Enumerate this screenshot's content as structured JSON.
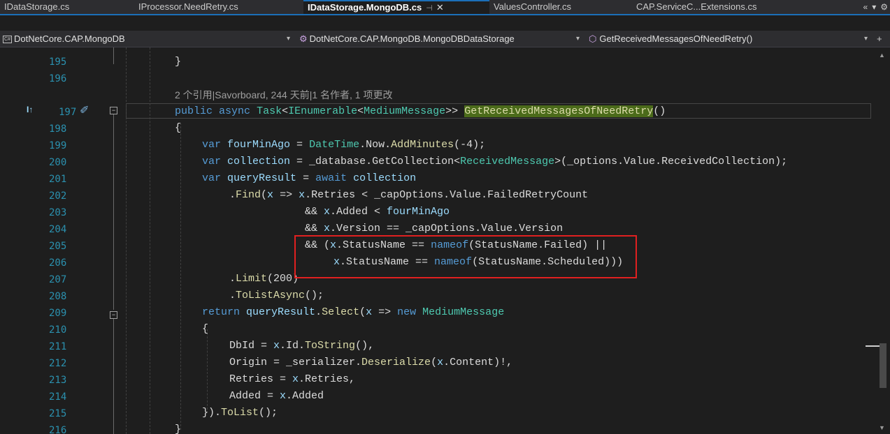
{
  "tabs": [
    {
      "label": "IDataStorage.cs",
      "active": false
    },
    {
      "label": "IProcessor.NeedRetry.cs",
      "active": false
    },
    {
      "label": "IDataStorage.MongoDB.cs",
      "active": true,
      "pin": "⊣",
      "close": "✕"
    },
    {
      "label": "ValuesController.cs",
      "active": false
    },
    {
      "label": "CAP.ServiceC...Extensions.cs",
      "active": false
    }
  ],
  "tab_icons": {
    "overflow": "«",
    "dropdown": "▾",
    "settings": "⚙"
  },
  "nav": {
    "project": "DotNetCore.CAP.MongoDB",
    "class": "DotNetCore.CAP.MongoDB.MongoDBDataStorage",
    "member": "GetReceivedMessagesOfNeedRetry()",
    "split": "+",
    "dropdown": "▾"
  },
  "codelens": "2 个引用|Savorboard, 244 天前|1 名作者, 1 项更改",
  "gutter": {
    "status_icon": "I↑",
    "pencil": "✐"
  },
  "lines": [
    {
      "n": "195",
      "text": "}"
    },
    {
      "n": "196",
      "text": ""
    },
    {
      "n": "197",
      "text": "public async Task<IEnumerable<MediumMessage>> GetReceivedMessagesOfNeedRetry()"
    },
    {
      "n": "198",
      "text": "{"
    },
    {
      "n": "199",
      "text": "var fourMinAgo = DateTime.Now.AddMinutes(-4);"
    },
    {
      "n": "200",
      "text": "var collection = _database.GetCollection<ReceivedMessage>(_options.Value.ReceivedCollection);"
    },
    {
      "n": "201",
      "text": "var queryResult = await collection"
    },
    {
      "n": "202",
      "text": ".Find(x => x.Retries < _capOptions.Value.FailedRetryCount"
    },
    {
      "n": "203",
      "text": "&& x.Added < fourMinAgo"
    },
    {
      "n": "204",
      "text": "&& x.Version == _capOptions.Value.Version"
    },
    {
      "n": "205",
      "text": "&& (x.StatusName == nameof(StatusName.Failed) ||"
    },
    {
      "n": "206",
      "text": "x.StatusName == nameof(StatusName.Scheduled)))"
    },
    {
      "n": "207",
      "text": ".Limit(200)"
    },
    {
      "n": "208",
      "text": ".ToListAsync();"
    },
    {
      "n": "209",
      "text": "return queryResult.Select(x => new MediumMessage"
    },
    {
      "n": "210",
      "text": "{"
    },
    {
      "n": "211",
      "text": "DbId = x.Id.ToString(),"
    },
    {
      "n": "212",
      "text": "Origin = _serializer.Deserialize(x.Content)!,"
    },
    {
      "n": "213",
      "text": "Retries = x.Retries,"
    },
    {
      "n": "214",
      "text": "Added = x.Added"
    },
    {
      "n": "215",
      "text": "}).ToList();"
    },
    {
      "n": "216",
      "text": "}"
    }
  ]
}
